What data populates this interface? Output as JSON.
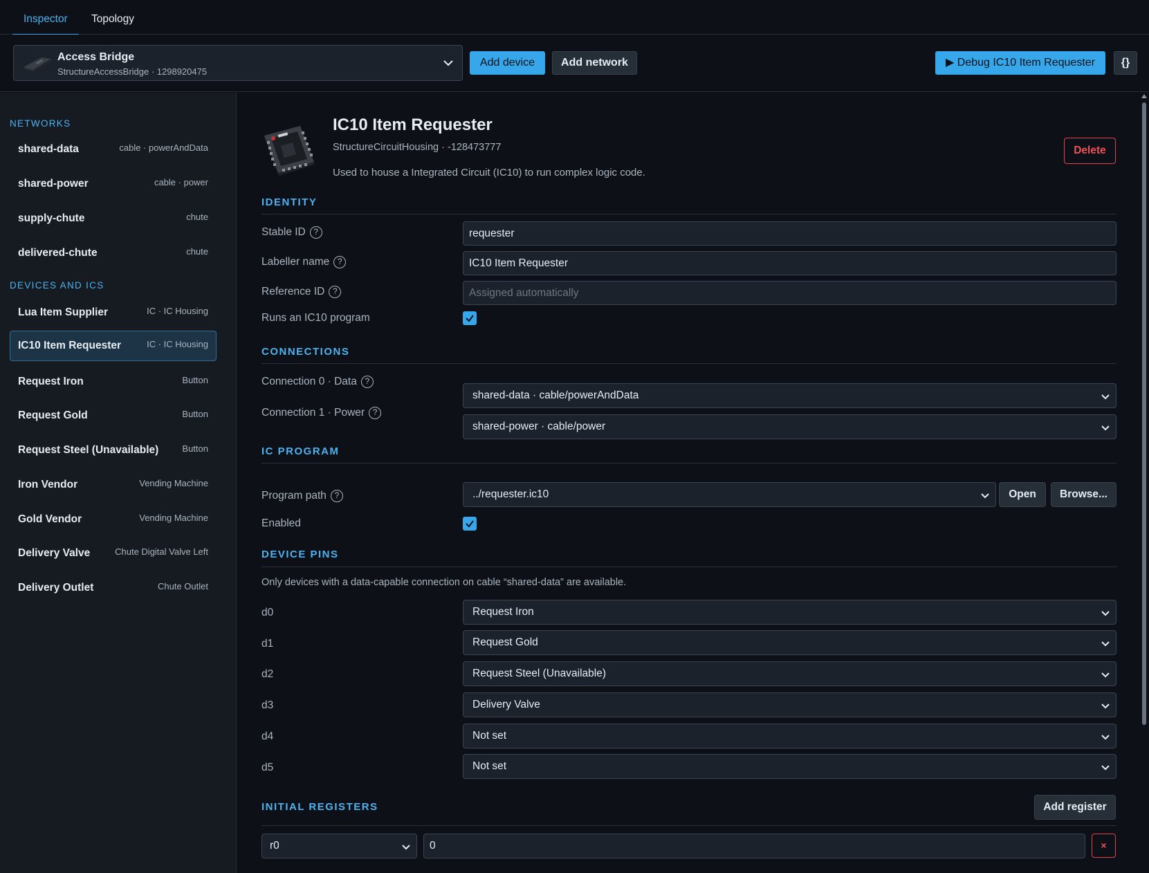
{
  "tabs": [
    {
      "label": "Inspector",
      "active": true
    },
    {
      "label": "Topology",
      "active": false
    }
  ],
  "toolbar": {
    "device_name": "Access Bridge",
    "device_sub": "StructureAccessBridge · 1298920475",
    "add_device": "Add device",
    "add_network": "Add network",
    "debug": "▶ Debug IC10 Item Requester",
    "json_button": "{}"
  },
  "sidebar": {
    "networks_label": "NETWORKS",
    "networks": [
      {
        "name": "shared-data",
        "type": "cable · powerAndData"
      },
      {
        "name": "shared-power",
        "type": "cable · power"
      },
      {
        "name": "supply-chute",
        "type": "chute"
      },
      {
        "name": "delivered-chute",
        "type": "chute"
      }
    ],
    "devices_label": "DEVICES AND ICS",
    "devices": [
      {
        "name": "Lua Item Supplier",
        "type": "IC · IC Housing"
      },
      {
        "name": "IC10 Item Requester",
        "type": "IC · IC Housing",
        "selected": true
      },
      {
        "name": "Request Iron",
        "type": "Button"
      },
      {
        "name": "Request Gold",
        "type": "Button"
      },
      {
        "name": "Request Steel (Unavailable)",
        "type": "Button"
      },
      {
        "name": "Iron Vendor",
        "type": "Vending Machine"
      },
      {
        "name": "Gold Vendor",
        "type": "Vending Machine"
      },
      {
        "name": "Delivery Valve",
        "type": "Chute Digital Valve Left"
      },
      {
        "name": "Delivery Outlet",
        "type": "Chute Outlet"
      }
    ]
  },
  "header": {
    "title": "IC10 Item Requester",
    "subtitle": "StructureCircuitHousing · -128473777",
    "description": "Used to house a Integrated Circuit (IC10) to run complex logic code.",
    "delete": "Delete"
  },
  "identity": {
    "title": "IDENTITY",
    "stable_id_label": "Stable ID",
    "stable_id_value": "requester",
    "labeller_label": "Labeller name",
    "labeller_value": "IC10 Item Requester",
    "reference_label": "Reference ID",
    "reference_placeholder": "Assigned automatically",
    "runs_label": "Runs an IC10 program",
    "runs_checked": true
  },
  "connections": {
    "title": "CONNECTIONS",
    "items": [
      {
        "label": "Connection 0 · Data",
        "value": "shared-data · cable/powerAndData"
      },
      {
        "label": "Connection 1 · Power",
        "value": "shared-power · cable/power"
      }
    ]
  },
  "ic_program": {
    "title": "IC PROGRAM",
    "path_label": "Program path",
    "path_value": "../requester.ic10",
    "open": "Open",
    "browse": "Browse...",
    "enabled_label": "Enabled",
    "enabled_checked": true
  },
  "device_pins": {
    "title": "DEVICE PINS",
    "note": "Only devices with a data-capable connection on cable “shared-data” are available.",
    "pins": [
      {
        "label": "d0",
        "value": "Request Iron"
      },
      {
        "label": "d1",
        "value": "Request Gold"
      },
      {
        "label": "d2",
        "value": "Request Steel (Unavailable)"
      },
      {
        "label": "d3",
        "value": "Delivery Valve"
      },
      {
        "label": "d4",
        "value": "Not set"
      },
      {
        "label": "d5",
        "value": "Not set"
      }
    ]
  },
  "registers": {
    "title": "INITIAL REGISTERS",
    "add": "Add register",
    "rows": [
      {
        "register": "r0",
        "value": "0",
        "remove": "×"
      }
    ]
  },
  "colors": {
    "accent": "#35a7ea",
    "background": "#0d1117",
    "sidebar": "#161b22",
    "danger": "#f0525a"
  },
  "icons": [
    "chevron-down-icon",
    "help-icon",
    "check-icon",
    "play-icon",
    "close-icon"
  ]
}
